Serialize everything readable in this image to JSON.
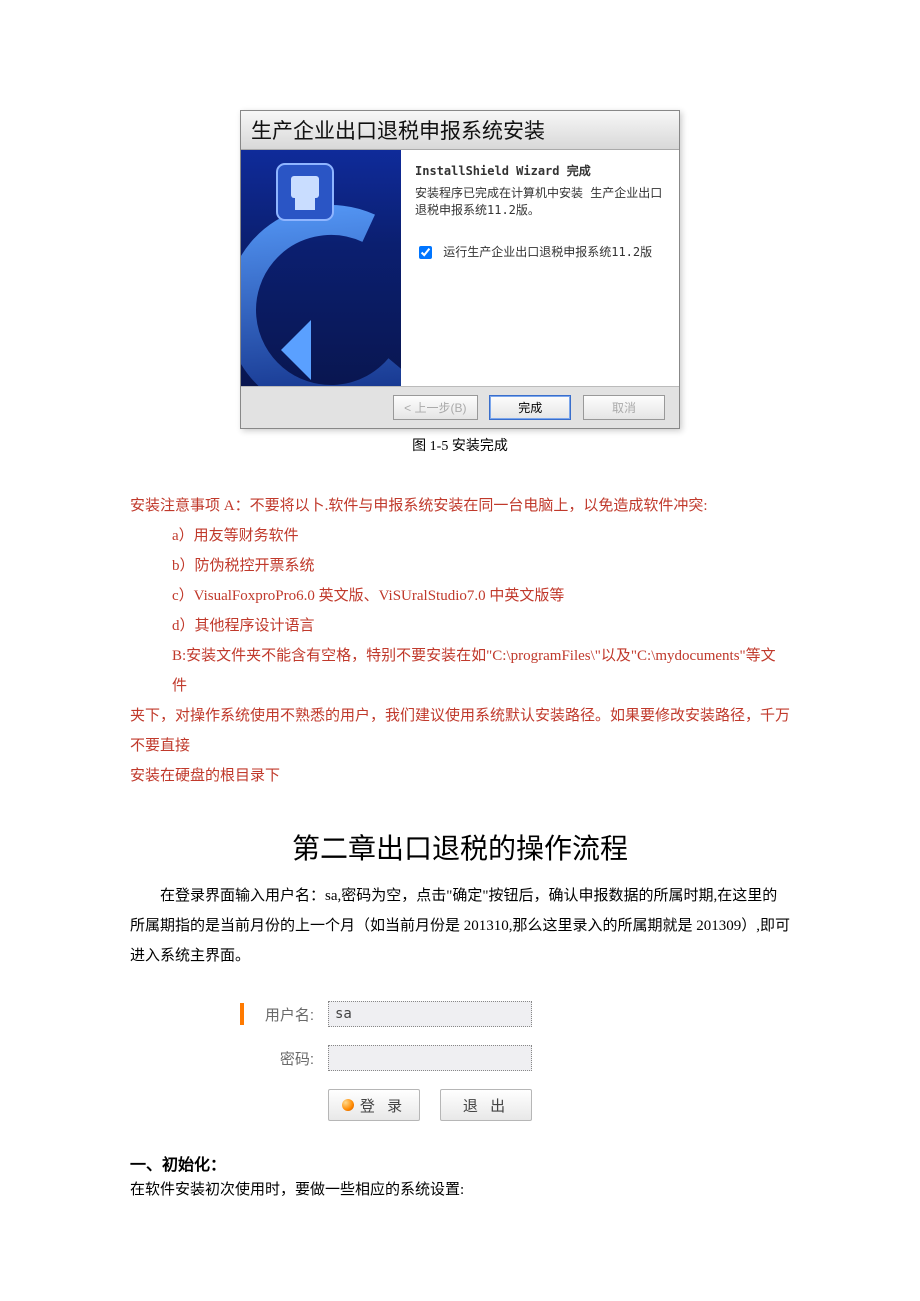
{
  "installer": {
    "title": "生产企业出口退税申报系统安装",
    "heading": "InstallShield Wizard 完成",
    "desc": "安装程序已完成在计算机中安装 生产企业出口退税申报系统11.2版。",
    "checkbox_label": "运行生产企业出口退税申报系统11.2版",
    "btn_back": "< 上一步(B)",
    "btn_finish": "完成",
    "btn_cancel": "取消"
  },
  "caption": "图 1-5 安装完成",
  "notice": {
    "lead": "安装注意事项 A：不要将以卜.软件与申报系统安装在同一台电脑上，以免造成软件冲突:",
    "a": "a）用友等财务软件",
    "b": "b）防伪税控开票系统",
    "c": "c）VisualFoxproPro6.0 英文版、ViSUralStudio7.0 中英文版等",
    "d": "d）其他程序设计语言",
    "p2a": "B:安装文件夹不能含有空格，特别不要安装在如\"C:\\programFiles\\\"以及\"C:\\mydocuments\"等文件",
    "p2b": "夹下，对操作系统使用不熟悉的用户，我们建议使用系统默认安装路径。如果要修改安装路径，千万不要直接",
    "p2c": "安装在硬盘的根目录下"
  },
  "chapter_title": "第二章出口退税的操作流程",
  "intro": "在登录界面输入用户名：sa,密码为空，点击\"确定\"按钮后，确认申报数据的所属时期,在这里的所属期指的是当前月份的上一个月（如当前月份是 201310,那么这里录入的所属期就是 201309）,即可进入系统主界面。",
  "login": {
    "user_label": "用户名:",
    "user_value": "sa",
    "pass_label": "密码:",
    "btn_login": "登 录",
    "btn_exit": "退 出"
  },
  "section1_head": "一、初始化：",
  "section1_line": "在软件安装初次使用时，要做一些相应的系统设置:"
}
